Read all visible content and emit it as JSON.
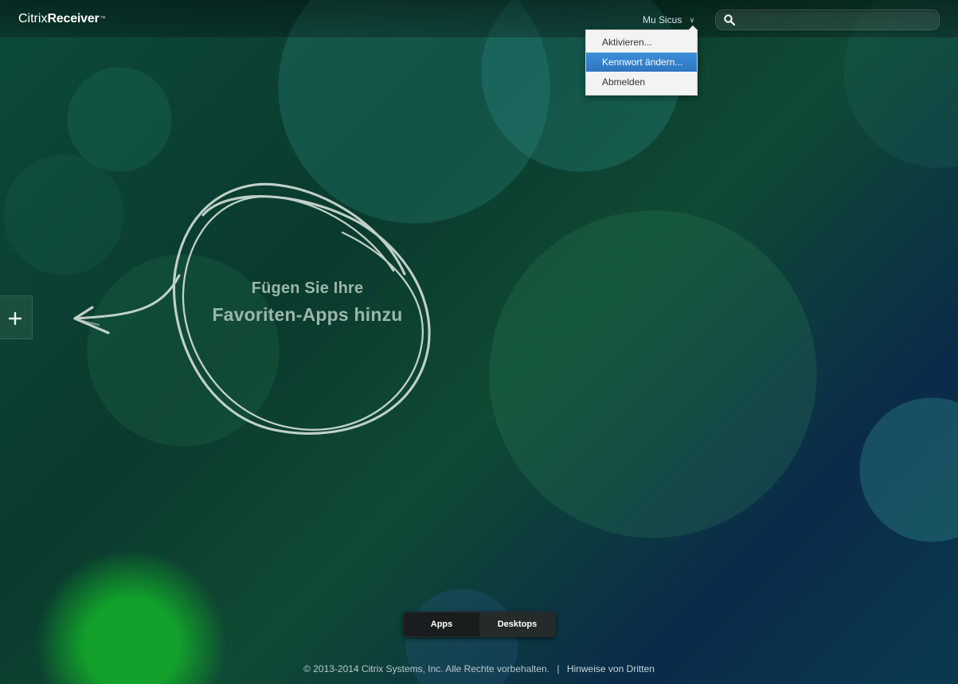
{
  "brand": {
    "part1": "Citrix",
    "part2": "Receiver",
    "tm": "™"
  },
  "header": {
    "user_name": "Mu Sicus",
    "search_placeholder": ""
  },
  "user_menu": {
    "items": [
      {
        "label": "Aktivieren..."
      },
      {
        "label": "Kennwort ändern...",
        "highlighted": true
      },
      {
        "label": "Abmelden"
      }
    ]
  },
  "empty_state": {
    "line1": "Fügen Sie Ihre",
    "line2": "Favoriten-Apps hinzu"
  },
  "bottom_switch": {
    "apps_label": "Apps",
    "desktops_label": "Desktops",
    "selected": "Apps"
  },
  "footer": {
    "copyright": "© 2013-2014 Citrix Systems, Inc. Alle Rechte vorbehalten.",
    "separator": "|",
    "third_party_link": "Hinweise von Dritten"
  },
  "colors": {
    "menu_highlight": "#2f75c1",
    "chalk_text": "#9bb7a8"
  },
  "icons": {
    "search": "search-icon",
    "user_menu_chevron": "chevron-down-icon",
    "add": "plus-icon",
    "doodle": "chalk-circle-arrow"
  }
}
